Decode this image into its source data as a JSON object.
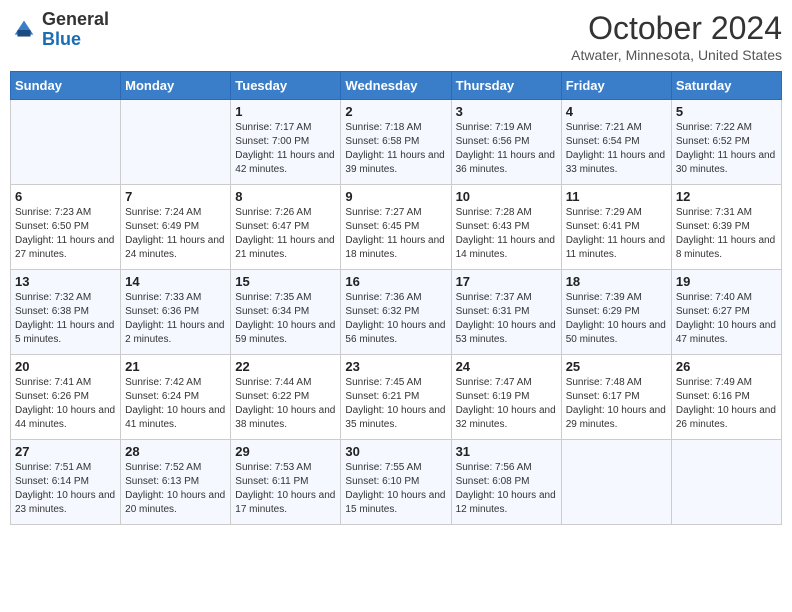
{
  "header": {
    "logo_general": "General",
    "logo_blue": "Blue",
    "month_title": "October 2024",
    "location": "Atwater, Minnesota, United States"
  },
  "weekdays": [
    "Sunday",
    "Monday",
    "Tuesday",
    "Wednesday",
    "Thursday",
    "Friday",
    "Saturday"
  ],
  "weeks": [
    [
      {
        "day": "",
        "info": ""
      },
      {
        "day": "",
        "info": ""
      },
      {
        "day": "1",
        "info": "Sunrise: 7:17 AM\nSunset: 7:00 PM\nDaylight: 11 hours and 42 minutes."
      },
      {
        "day": "2",
        "info": "Sunrise: 7:18 AM\nSunset: 6:58 PM\nDaylight: 11 hours and 39 minutes."
      },
      {
        "day": "3",
        "info": "Sunrise: 7:19 AM\nSunset: 6:56 PM\nDaylight: 11 hours and 36 minutes."
      },
      {
        "day": "4",
        "info": "Sunrise: 7:21 AM\nSunset: 6:54 PM\nDaylight: 11 hours and 33 minutes."
      },
      {
        "day": "5",
        "info": "Sunrise: 7:22 AM\nSunset: 6:52 PM\nDaylight: 11 hours and 30 minutes."
      }
    ],
    [
      {
        "day": "6",
        "info": "Sunrise: 7:23 AM\nSunset: 6:50 PM\nDaylight: 11 hours and 27 minutes."
      },
      {
        "day": "7",
        "info": "Sunrise: 7:24 AM\nSunset: 6:49 PM\nDaylight: 11 hours and 24 minutes."
      },
      {
        "day": "8",
        "info": "Sunrise: 7:26 AM\nSunset: 6:47 PM\nDaylight: 11 hours and 21 minutes."
      },
      {
        "day": "9",
        "info": "Sunrise: 7:27 AM\nSunset: 6:45 PM\nDaylight: 11 hours and 18 minutes."
      },
      {
        "day": "10",
        "info": "Sunrise: 7:28 AM\nSunset: 6:43 PM\nDaylight: 11 hours and 14 minutes."
      },
      {
        "day": "11",
        "info": "Sunrise: 7:29 AM\nSunset: 6:41 PM\nDaylight: 11 hours and 11 minutes."
      },
      {
        "day": "12",
        "info": "Sunrise: 7:31 AM\nSunset: 6:39 PM\nDaylight: 11 hours and 8 minutes."
      }
    ],
    [
      {
        "day": "13",
        "info": "Sunrise: 7:32 AM\nSunset: 6:38 PM\nDaylight: 11 hours and 5 minutes."
      },
      {
        "day": "14",
        "info": "Sunrise: 7:33 AM\nSunset: 6:36 PM\nDaylight: 11 hours and 2 minutes."
      },
      {
        "day": "15",
        "info": "Sunrise: 7:35 AM\nSunset: 6:34 PM\nDaylight: 10 hours and 59 minutes."
      },
      {
        "day": "16",
        "info": "Sunrise: 7:36 AM\nSunset: 6:32 PM\nDaylight: 10 hours and 56 minutes."
      },
      {
        "day": "17",
        "info": "Sunrise: 7:37 AM\nSunset: 6:31 PM\nDaylight: 10 hours and 53 minutes."
      },
      {
        "day": "18",
        "info": "Sunrise: 7:39 AM\nSunset: 6:29 PM\nDaylight: 10 hours and 50 minutes."
      },
      {
        "day": "19",
        "info": "Sunrise: 7:40 AM\nSunset: 6:27 PM\nDaylight: 10 hours and 47 minutes."
      }
    ],
    [
      {
        "day": "20",
        "info": "Sunrise: 7:41 AM\nSunset: 6:26 PM\nDaylight: 10 hours and 44 minutes."
      },
      {
        "day": "21",
        "info": "Sunrise: 7:42 AM\nSunset: 6:24 PM\nDaylight: 10 hours and 41 minutes."
      },
      {
        "day": "22",
        "info": "Sunrise: 7:44 AM\nSunset: 6:22 PM\nDaylight: 10 hours and 38 minutes."
      },
      {
        "day": "23",
        "info": "Sunrise: 7:45 AM\nSunset: 6:21 PM\nDaylight: 10 hours and 35 minutes."
      },
      {
        "day": "24",
        "info": "Sunrise: 7:47 AM\nSunset: 6:19 PM\nDaylight: 10 hours and 32 minutes."
      },
      {
        "day": "25",
        "info": "Sunrise: 7:48 AM\nSunset: 6:17 PM\nDaylight: 10 hours and 29 minutes."
      },
      {
        "day": "26",
        "info": "Sunrise: 7:49 AM\nSunset: 6:16 PM\nDaylight: 10 hours and 26 minutes."
      }
    ],
    [
      {
        "day": "27",
        "info": "Sunrise: 7:51 AM\nSunset: 6:14 PM\nDaylight: 10 hours and 23 minutes."
      },
      {
        "day": "28",
        "info": "Sunrise: 7:52 AM\nSunset: 6:13 PM\nDaylight: 10 hours and 20 minutes."
      },
      {
        "day": "29",
        "info": "Sunrise: 7:53 AM\nSunset: 6:11 PM\nDaylight: 10 hours and 17 minutes."
      },
      {
        "day": "30",
        "info": "Sunrise: 7:55 AM\nSunset: 6:10 PM\nDaylight: 10 hours and 15 minutes."
      },
      {
        "day": "31",
        "info": "Sunrise: 7:56 AM\nSunset: 6:08 PM\nDaylight: 10 hours and 12 minutes."
      },
      {
        "day": "",
        "info": ""
      },
      {
        "day": "",
        "info": ""
      }
    ]
  ]
}
